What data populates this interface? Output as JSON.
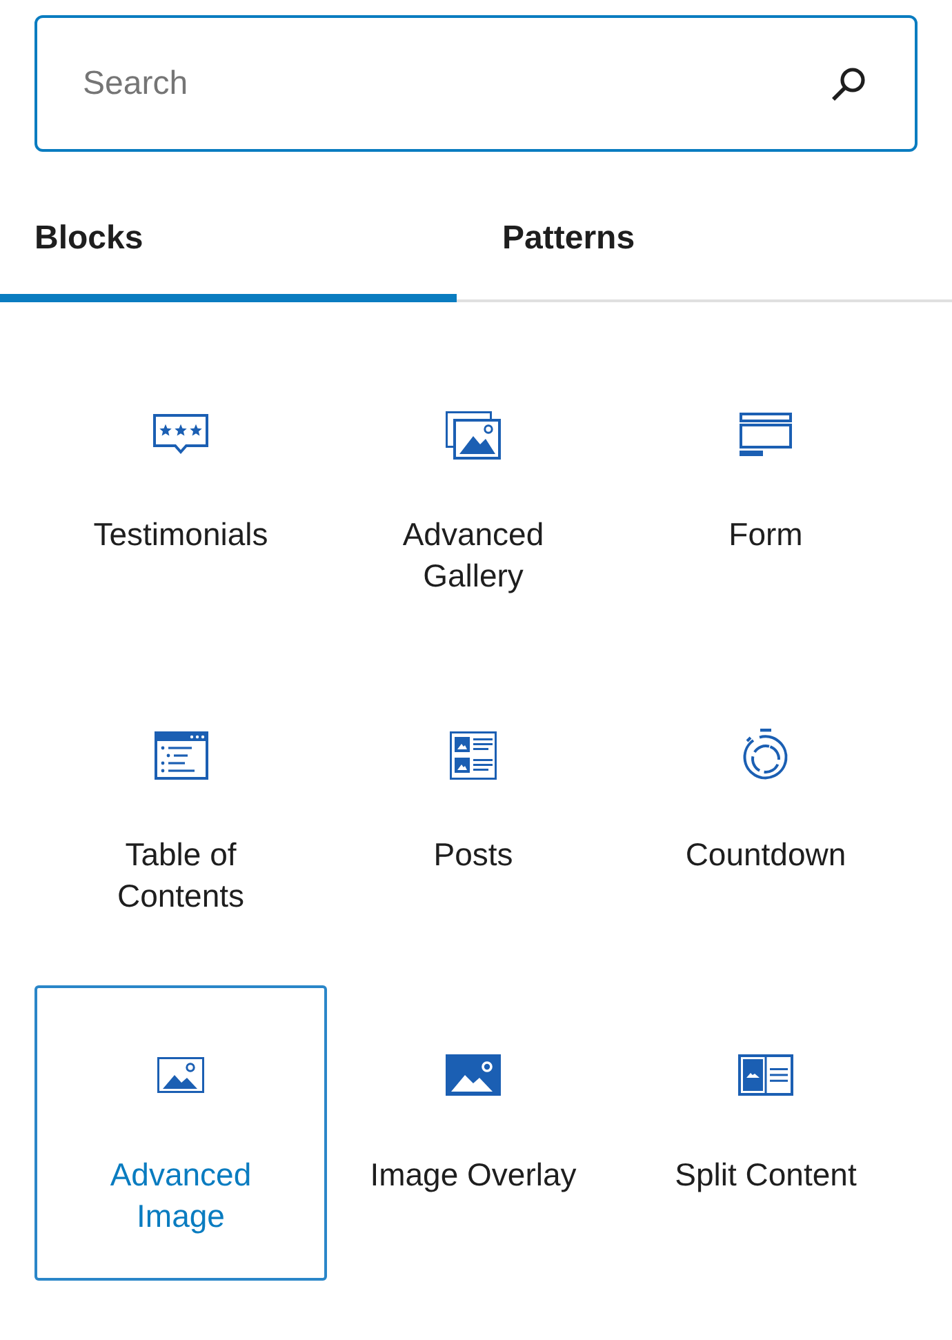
{
  "search": {
    "placeholder": "Search"
  },
  "tabs": [
    {
      "label": "Blocks",
      "selected": true
    },
    {
      "label": "Patterns",
      "selected": false
    }
  ],
  "blocks": [
    {
      "label": "Testimonials",
      "selected": false
    },
    {
      "label": "Advanced Gallery",
      "selected": false
    },
    {
      "label": "Form",
      "selected": false
    },
    {
      "label": "Table of Contents",
      "selected": false
    },
    {
      "label": "Posts",
      "selected": false
    },
    {
      "label": "Countdown",
      "selected": false
    },
    {
      "label": "Advanced Image",
      "selected": true
    },
    {
      "label": "Image Overlay",
      "selected": false
    },
    {
      "label": "Split Content",
      "selected": false
    }
  ]
}
